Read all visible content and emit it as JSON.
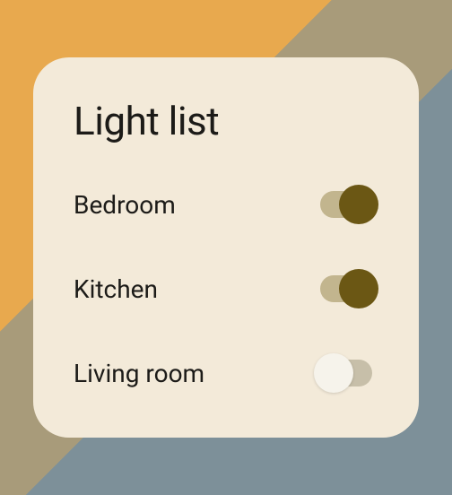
{
  "card": {
    "title": "Light list"
  },
  "lights": [
    {
      "label": "Bedroom",
      "state": "on"
    },
    {
      "label": "Kitchen",
      "state": "on"
    },
    {
      "label": "Living room",
      "state": "off"
    }
  ],
  "colors": {
    "card_bg": "#f3ead9",
    "on_thumb": "#6b5714",
    "on_track": "#c2b58e",
    "off_thumb": "#f6f3eb",
    "off_track": "#c7bfa9"
  }
}
